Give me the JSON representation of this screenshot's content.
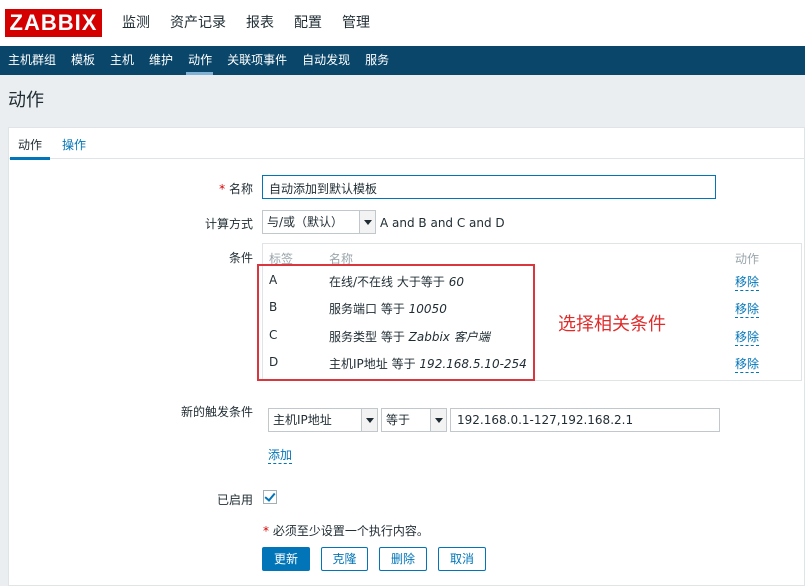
{
  "logo": "ZABBIX",
  "top_nav": [
    "监测",
    "资产记录",
    "报表",
    "配置",
    "管理"
  ],
  "sub_nav": [
    "主机群组",
    "模板",
    "主机",
    "维护",
    "动作",
    "关联项事件",
    "自动发现",
    "服务"
  ],
  "page_title": "动作",
  "tabs": [
    "动作",
    "操作"
  ],
  "form": {
    "name_required": "*",
    "name_label": "名称",
    "name_value": "自动添加到默认模板",
    "calc_label": "计算方式",
    "calc_value": "与/或（默认）",
    "calc_expr": "A and B and C and D",
    "conditions_label": "条件",
    "cond_headers": {
      "label": "标签",
      "name": "名称",
      "action": "动作"
    },
    "conditions": [
      {
        "label": "A",
        "text": "在线/不在线 大于等于",
        "value": "60",
        "remove": "移除"
      },
      {
        "label": "B",
        "text": "服务端口 等于",
        "value": "10050",
        "remove": "移除"
      },
      {
        "label": "C",
        "text": "服务类型 等于",
        "value": "Zabbix 客户端",
        "remove": "移除"
      },
      {
        "label": "D",
        "text": "主机IP地址 等于",
        "value": "192.168.5.10-254",
        "remove": "移除"
      }
    ],
    "annotation": "选择相关条件",
    "new_cond_label": "新的触发条件",
    "new_cond_type": "主机IP地址",
    "new_cond_op": "等于",
    "new_cond_value": "192.168.0.1-127,192.168.2.1",
    "add_link": "添加",
    "enabled_label": "已启用",
    "required_note_star": "*",
    "required_note": "必须至少设置一个执行内容。",
    "buttons": {
      "update": "更新",
      "clone": "克隆",
      "delete": "删除",
      "cancel": "取消"
    }
  }
}
